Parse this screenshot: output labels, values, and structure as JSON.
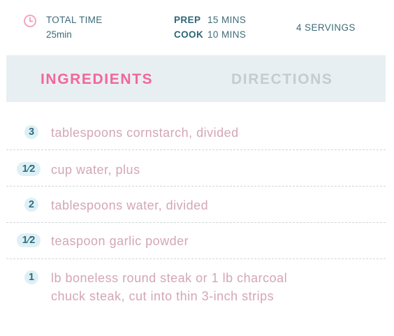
{
  "meta": {
    "total_time_label": "TOTAL TIME",
    "total_time_value": "25min",
    "prep_label": "PREP",
    "prep_value": "15 MINS",
    "cook_label": "COOK",
    "cook_value": "10 MINS",
    "servings": "4 SERVINGS",
    "clock_icon": "clock-icon"
  },
  "tabs": [
    {
      "label": "INGREDIENTS",
      "active": true
    },
    {
      "label": "DIRECTIONS",
      "active": false
    }
  ],
  "ingredients": [
    {
      "qty": "3",
      "text_lines": [
        "tablespoons cornstarch, divided"
      ]
    },
    {
      "qty": "1⁄2",
      "text_lines": [
        "cup water, plus"
      ]
    },
    {
      "qty": "2",
      "text_lines": [
        "tablespoons water, divided"
      ]
    },
    {
      "qty": "1⁄2",
      "text_lines": [
        "teaspoon garlic powder"
      ]
    },
    {
      "qty": "1",
      "text_lines": [
        "lb boneless round steak or 1 lb charcoal",
        "chuck steak, cut into thin 3-inch strips"
      ]
    }
  ],
  "colors": {
    "accent_pink": "#f2669a",
    "tab_inactive": "#c5ccd1",
    "tab_bg": "#e8eff3",
    "meta_text": "#3d6b78",
    "ingredient_text": "#d3a6b6",
    "badge_bg": "#def0f5",
    "badge_text": "#2e6d7f"
  }
}
